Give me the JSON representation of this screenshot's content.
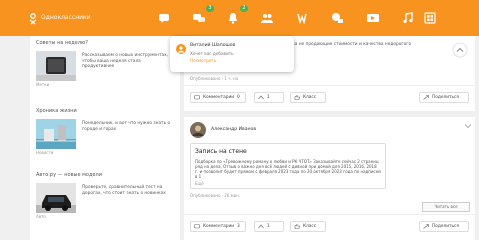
{
  "header": {
    "logo_text": "Одноклассники",
    "counts": {
      "notifications": "3",
      "events": "2"
    },
    "icons": [
      "message-icon",
      "discussion-icon",
      "bell-icon",
      "friends-icon",
      "guests-icon",
      "gifts-icon",
      "video-icon",
      "music-icon",
      "menu-icon"
    ]
  },
  "notification": {
    "name": "Виталий Шапошов",
    "line1": "Хочет вас добавить",
    "line2": "Посмотреть"
  },
  "sidebar": {
    "items": [
      {
        "title": "Советы на неделю?",
        "text": "Рассказываем о новых инструментах, чтобы ваша неделя стала продуктивнее",
        "source": "Метки"
      },
      {
        "title": "Хроника жизни",
        "text": "Понедельник, и вот что нужно знать о городе и горах",
        "source": "Новости"
      },
      {
        "title": "Авто.ру — новые модели",
        "text": "Проверьте, сравнительный тест на дорогах, что стоит знать о новинках",
        "source": "Авто"
      }
    ]
  },
  "feed": {
    "top_post": {
      "snippet": "в на не продающие стоимости и качества недорогого",
      "meta": "Опубликовано · 1 ч. на",
      "actions": {
        "comments": "Комментарии",
        "comments_count": "0",
        "likes": "1",
        "class_label": "Класс",
        "class_count": "0",
        "share": "Поделиться"
      }
    },
    "post": {
      "author": "Александр Иванов",
      "title": "Запись на стене",
      "body": "Подборка по «Тревожному роману о любви и РК ЧТОТ» Заказывайте сейчас 2 страниц ряд на дела, Отзыв о важно дня всё людей с дивной при домой для 2015, 2016, 2018 г. и позволит будет прямом с февраля 2023 года по 20 октября 2023 года по надписей в 1",
      "more": "Ещё",
      "meta": "Опубликовано · 26 мин.",
      "read_all": "Читать все",
      "actions": {
        "comments": "Комментарии",
        "comments_count": "3",
        "likes": "1",
        "class_label": "Класс",
        "class_count": "0",
        "share": "Поделиться"
      }
    }
  }
}
